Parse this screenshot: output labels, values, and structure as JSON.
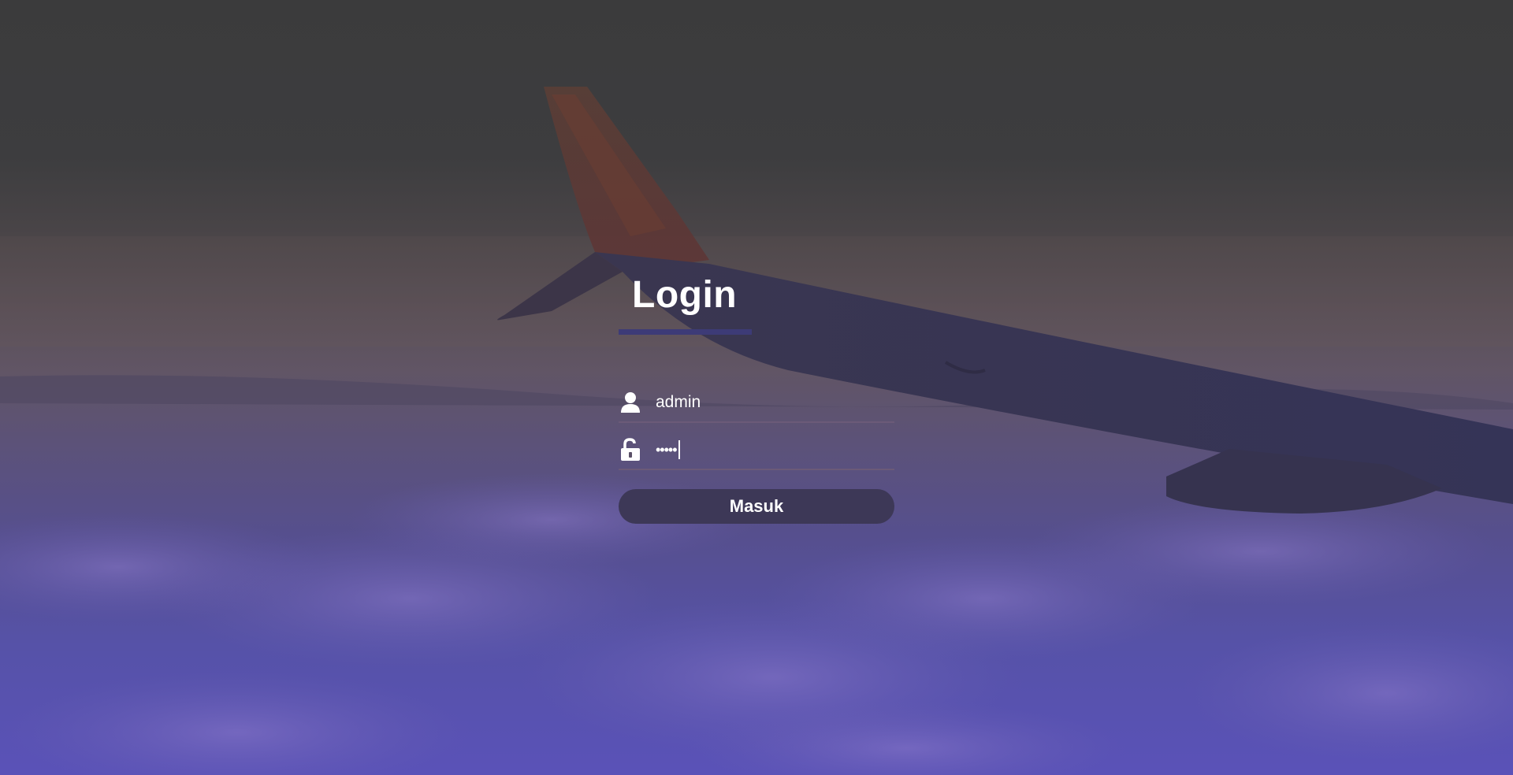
{
  "login": {
    "title": "Login",
    "username_value": "admin",
    "password_mask": "•••••",
    "submit_label": "Masuk"
  },
  "icons": {
    "user": "user-icon",
    "password": "unlock-icon"
  },
  "colors": {
    "accent_underline": "#3d3b77",
    "button_bg": "#3d3857",
    "text": "#ffffff"
  }
}
